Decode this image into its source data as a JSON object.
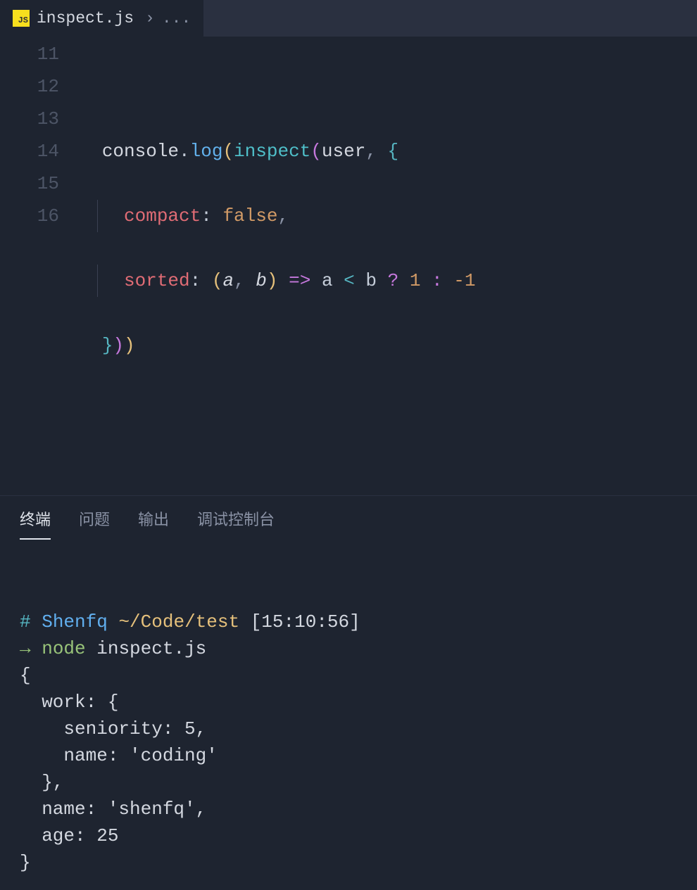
{
  "tab": {
    "icon_label": "JS",
    "filename": "inspect.js",
    "breadcrumb_sep": "›",
    "breadcrumb_rest": "..."
  },
  "editor": {
    "lines": [
      {
        "num": "11"
      },
      {
        "num": "12"
      },
      {
        "num": "13"
      },
      {
        "num": "14"
      },
      {
        "num": "15"
      },
      {
        "num": "16"
      }
    ],
    "code": {
      "l12": {
        "console": "console",
        "dot": ".",
        "log": "log",
        "lp1": "(",
        "inspect": "inspect",
        "lp2": "(",
        "user": "user",
        "comma": ",",
        "lbrace": "{"
      },
      "l13": {
        "compact": "compact",
        "colon": ":",
        "false": "false",
        "comma": ","
      },
      "l14": {
        "sorted": "sorted",
        "colon": ":",
        "lp": "(",
        "a": "a",
        "comma1": ",",
        "b": "b",
        "rp": ")",
        "arrow": "=>",
        "a2": "a",
        "lt": "<",
        "b2": "b",
        "q": "?",
        "one": "1",
        "colon2": ":",
        "neg1": "-1"
      },
      "l15": {
        "rbrace": "}",
        "rp2": ")",
        "rp1": ")"
      }
    }
  },
  "panel": {
    "tabs": {
      "terminal": "终端",
      "problems": "问题",
      "output": "输出",
      "debug": "调试控制台"
    }
  },
  "terminal": {
    "prompt": {
      "hash": "#",
      "user": "Shenfq",
      "path": "~/Code/test",
      "time": "[15:10:56]"
    },
    "cmd": {
      "arrow": "→",
      "node": "node",
      "file": "inspect.js"
    },
    "output": {
      "l1": "{",
      "l2": "  work: {",
      "l3": "    seniority: 5,",
      "l4": "    name: 'coding'",
      "l5": "  },",
      "l6": "  name: 'shenfq',",
      "l7": "  age: 25",
      "l8": "}"
    }
  }
}
